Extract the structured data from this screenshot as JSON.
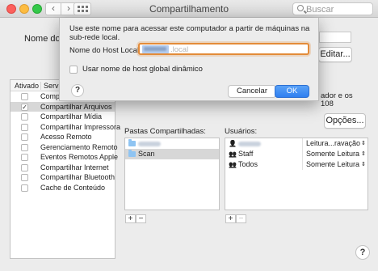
{
  "window": {
    "title": "Compartilhamento",
    "search_placeholder": "Buscar"
  },
  "background": {
    "computer_name_label": "Nome do C",
    "edit_button": "Editar...",
    "right_text_line1": "ador e os",
    "right_text_line2": "108",
    "options_button": "Opções...",
    "services_header": {
      "enabled": "Ativado",
      "service": "Serviço"
    },
    "services": [
      {
        "label": "Compartilhar Tela",
        "checked": false,
        "selected": false
      },
      {
        "label": "Compartilhar Arquivos",
        "checked": true,
        "selected": true
      },
      {
        "label": "Compartilhar Mídia",
        "checked": false,
        "selected": false
      },
      {
        "label": "Compartilhar Impressora",
        "checked": false,
        "selected": false
      },
      {
        "label": "Acesso Remoto",
        "checked": false,
        "selected": false
      },
      {
        "label": "Gerenciamento Remoto",
        "checked": false,
        "selected": false
      },
      {
        "label": "Eventos Remotos Apple",
        "checked": false,
        "selected": false
      },
      {
        "label": "Compartilhar Internet",
        "checked": false,
        "selected": false
      },
      {
        "label": "Compartilhar Bluetooth",
        "checked": false,
        "selected": false
      },
      {
        "label": "Cache de Conteúdo",
        "checked": false,
        "selected": false
      }
    ],
    "shared_folders_label": "Pastas Compartilhadas:",
    "shared_folders": [
      {
        "label": "",
        "selected": false
      },
      {
        "label": "Scan",
        "selected": true
      }
    ],
    "users_label": "Usuários:",
    "users": [
      {
        "label": "",
        "permission": "Leitura...ravação",
        "icon": "person-icon"
      },
      {
        "label": "Staff",
        "permission": "Somente Leitura",
        "icon": "group-icon"
      },
      {
        "label": "Todos",
        "permission": "Somente Leitura",
        "icon": "group-icon"
      }
    ],
    "add_symbol": "+",
    "remove_symbol": "−",
    "help_symbol": "?"
  },
  "dialog": {
    "description": "Use este nome para acessar este computador a partir de máquinas na sub-rede local.",
    "hostname_label": "Nome do Host Local:",
    "hostname_suffix": ".local",
    "global_hostname_label": "Usar nome de host global dinâmico",
    "global_hostname_checked": false,
    "help_symbol": "?",
    "cancel_label": "Cancelar",
    "ok_label": "OK"
  },
  "colors": {
    "ok_button": "#2f7ff0",
    "focus_ring": "#e38b39",
    "selection": "#d7d7d7"
  }
}
